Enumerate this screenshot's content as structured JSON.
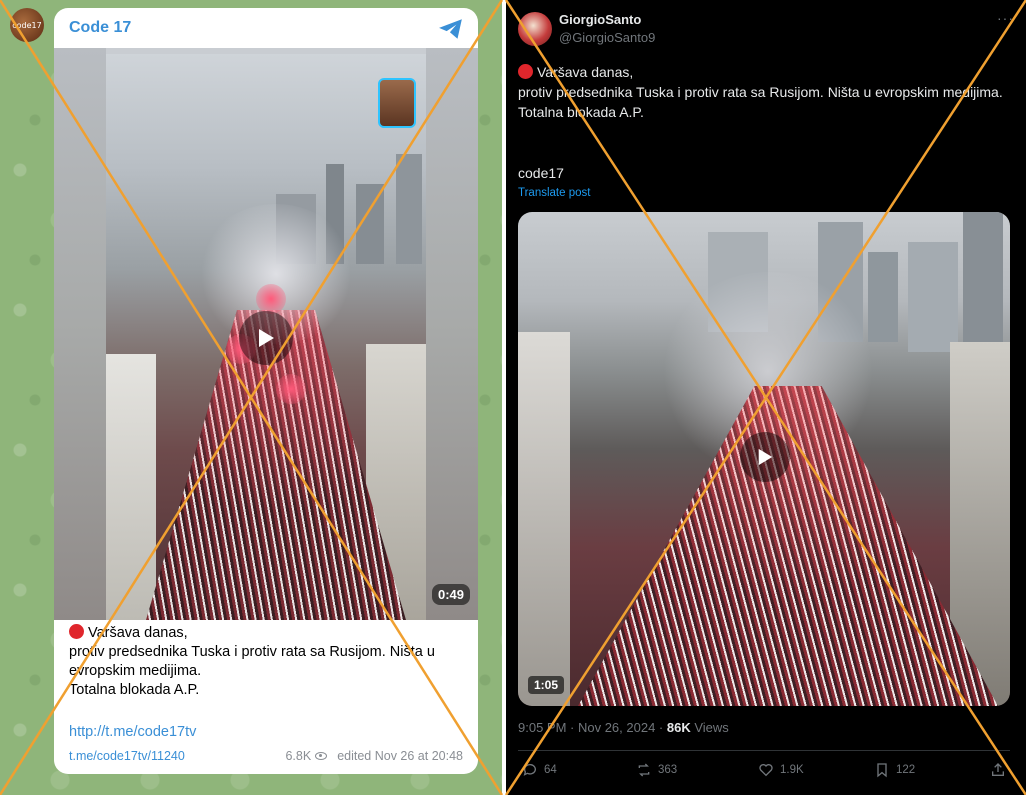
{
  "telegram": {
    "avatar_label": "code17",
    "channel_name": "Code 17",
    "duration": "0:49",
    "text_lines": [
      "Varšava danas,",
      "protiv predsednika Tuska i protiv rata sa Rusijom. Ništa u evropskim medijima.",
      "Totalna blokada A.P."
    ],
    "link": "http://t.me/code17tv",
    "post_link": "t.me/code17tv/11240",
    "views": "6.8K",
    "edited": "edited Nov 26 at 20:48"
  },
  "x_post": {
    "display_name": "GiorgioSanto",
    "handle": "@GiorgioSanto9",
    "more": "···",
    "text_lines": [
      "Varšava danas,",
      "protiv predsednika Tuska i protiv rata sa Rusijom. Ništa u evropskim medijima.",
      "Totalna blokada A.P."
    ],
    "code": "code17",
    "translate": "Translate post",
    "duration": "1:05",
    "timestamp": "9:05 PM · Nov 26, 2024 · ",
    "views_count": "86K",
    "views_label": " Views",
    "replies": "64",
    "reposts": "363",
    "likes": "1.9K",
    "bookmarks": "122"
  },
  "colors": {
    "telegram_accent": "#3a8fd6",
    "x_accent": "#1d9bf0",
    "cross_lines": "#f0a030",
    "red_dot": "#e0262c"
  },
  "icons": [
    "telegram-plane-icon",
    "eye-icon",
    "play-icon",
    "reply-icon",
    "repost-icon",
    "like-icon",
    "bookmark-icon",
    "share-icon"
  ]
}
